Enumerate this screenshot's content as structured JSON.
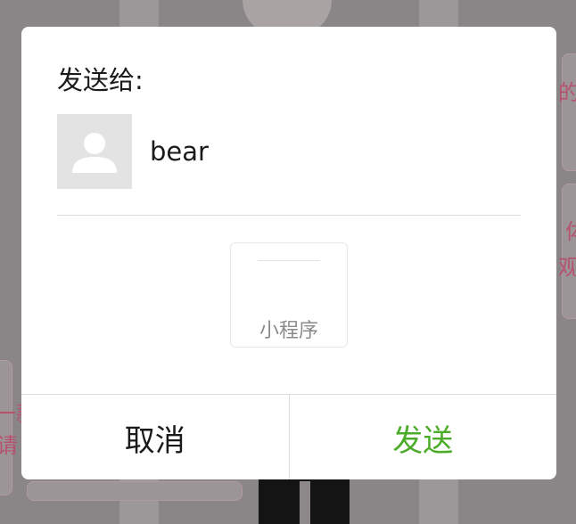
{
  "background": {
    "fragments": [
      "的",
      "体",
      "观念",
      "一款",
      "请"
    ]
  },
  "dialog": {
    "title": "发送给:",
    "contact": {
      "name": "bear",
      "avatar_icon": "default-avatar-icon"
    },
    "attachment": {
      "label": "小程序"
    },
    "buttons": {
      "cancel": "取消",
      "send": "发送"
    }
  },
  "colors": {
    "send_accent": "#4cac29",
    "overlay_text": "#b7526e"
  }
}
